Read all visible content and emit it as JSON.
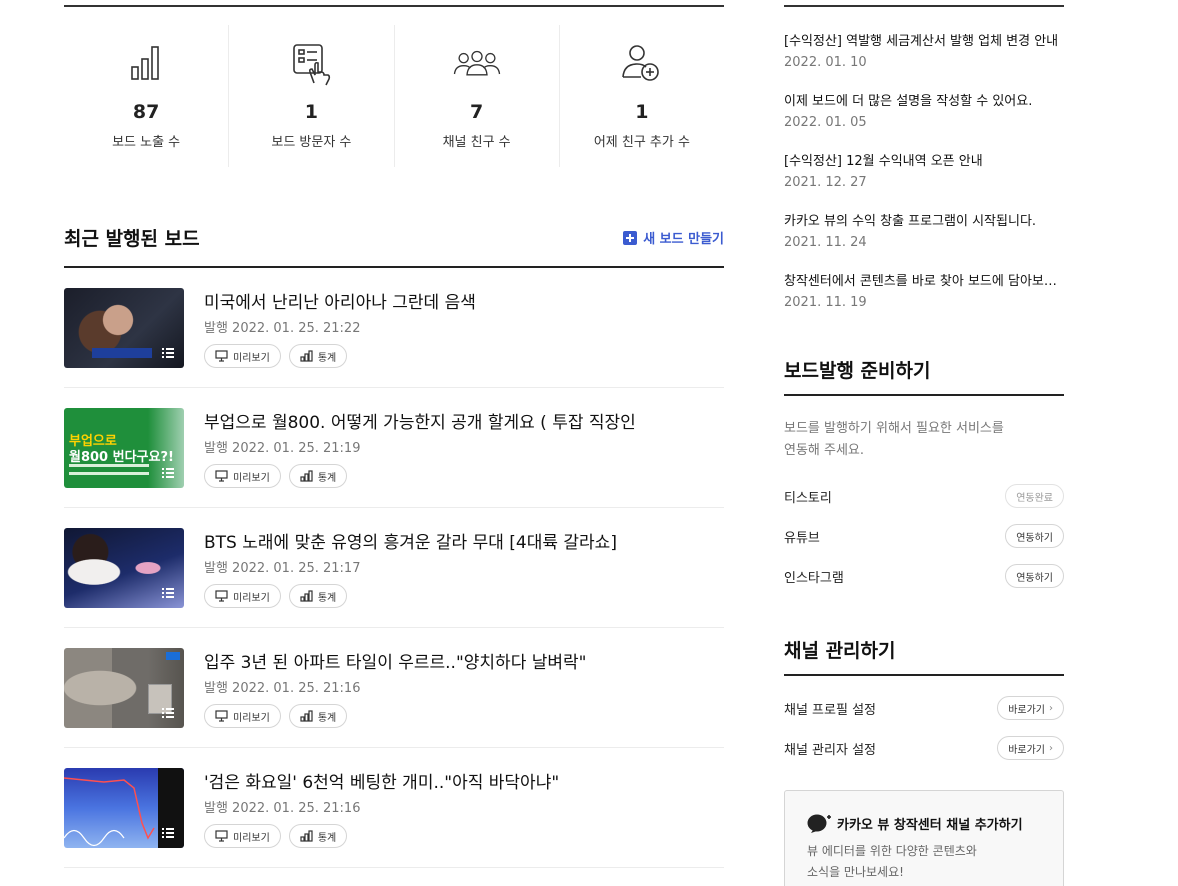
{
  "stats": [
    {
      "value": "87",
      "label": "보드 노출 수",
      "icon": "bar-chart-icon"
    },
    {
      "value": "1",
      "label": "보드 방문자 수",
      "icon": "board-visit-icon"
    },
    {
      "value": "7",
      "label": "채널 친구 수",
      "icon": "friends-icon"
    },
    {
      "value": "1",
      "label": "어제 친구 추가 수",
      "icon": "add-friend-icon"
    }
  ],
  "recent": {
    "title": "최근 발행된 보드",
    "new_board_label": "새 보드 만들기",
    "preview_label": "미리보기",
    "stats_label": "통계",
    "items": [
      {
        "title": "미국에서 난리난 아리아나 그란데 음색",
        "date": "발행 2022. 01. 25. 21:22"
      },
      {
        "title": "부업으로 월800. 어떻게 가능한지 공개 할게요 ( 투잡 직장인",
        "date": "발행 2022. 01. 25. 21:19"
      },
      {
        "title": "BTS 노래에 맞춘 유영의 흥겨운 갈라 무대 [4대륙 갈라쇼]",
        "date": "발행 2022. 01. 25. 21:17"
      },
      {
        "title": "입주 3년 된 아파트 타일이 우르르..\"양치하다 날벼락\"",
        "date": "발행 2022. 01. 25. 21:16"
      },
      {
        "title": "'검은 화요일' 6천억 베팅한 개미..\"아직 바닥아냐\"",
        "date": "발행 2022. 01. 25. 21:16"
      }
    ],
    "thumb2_text": {
      "line1": "부업으로",
      "line2": "월800 번다구요?!"
    }
  },
  "notices": [
    {
      "title": "[수익정산] 역발행 세금계산서 발행 업체 변경 안내",
      "date": "2022. 01. 10"
    },
    {
      "title": "이제 보드에 더 많은 설명을 작성할 수 있어요.",
      "date": "2022. 01. 05"
    },
    {
      "title": "[수익정산] 12월 수익내역 오픈 안내",
      "date": "2021. 12. 27"
    },
    {
      "title": "카카오 뷰의 수익 창출 프로그램이 시작됩니다.",
      "date": "2021. 11. 24"
    },
    {
      "title": "창작센터에서 콘텐츠를 바로 찾아 보드에 담아보세요",
      "date": "2021. 11. 19"
    }
  ],
  "prep": {
    "title": "보드발행 준비하기",
    "desc_line1": "보드를 발행하기 위해서 필요한 서비스를",
    "desc_line2": "연동해 주세요.",
    "services": [
      {
        "name": "티스토리",
        "button": "연동완료"
      },
      {
        "name": "유튜브",
        "button": "연동하기"
      },
      {
        "name": "인스타그램",
        "button": "연동하기"
      }
    ]
  },
  "manage": {
    "title": "채널 관리하기",
    "rows": [
      {
        "name": "채널 프로필 설정",
        "button": "바로가기"
      },
      {
        "name": "채널 관리자 설정",
        "button": "바로가기"
      }
    ]
  },
  "promo": {
    "badge": "Ch",
    "title": "카카오 뷰 창작센터 채널 추가하기",
    "desc_line1": "뷰 에디터를 위한 다양한 콘텐츠와",
    "desc_line2": "소식을 만나보세요!"
  },
  "colors": {
    "accent": "#3b5bd0",
    "rule": "#222222"
  }
}
